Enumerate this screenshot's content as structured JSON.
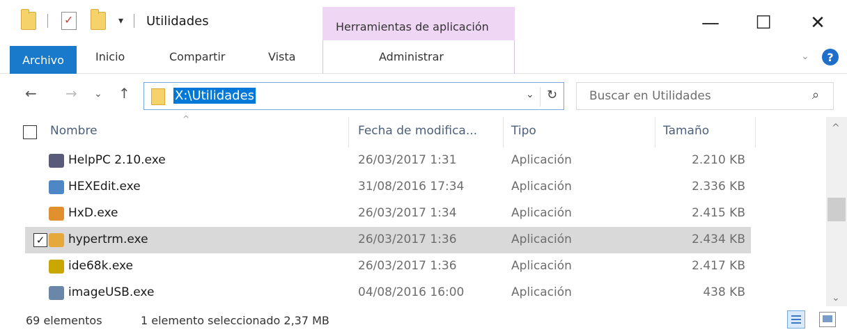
{
  "window": {
    "title": "Utilidades",
    "qa_dropdown": "▾",
    "minimize": "—",
    "maximize": "☐",
    "close": "✕"
  },
  "ribbon": {
    "contextual_header": "Herramientas de aplicación",
    "tabs": [
      "Archivo",
      "Inicio",
      "Compartir",
      "Vista"
    ],
    "contextual_tab": "Administrar",
    "expand": "⌄",
    "help": "?"
  },
  "navigation": {
    "back": "←",
    "forward": "→",
    "recent": "⌄",
    "up": "↑",
    "address": "X:\\Utilidades",
    "address_dropdown": "⌄",
    "refresh": "↻",
    "search_placeholder": "Buscar en Utilidades",
    "search_icon": "⌕"
  },
  "columns": {
    "name": "Nombre",
    "date": "Fecha de modifica...",
    "type": "Tipo",
    "size": "Tamaño",
    "sort_indicator": "^"
  },
  "files": [
    {
      "name": "HelpPC 2.10.exe",
      "date": "26/03/2017 1:31",
      "type": "Aplicación",
      "size": "2.210 KB",
      "icon": "helppc-icon",
      "icon_color": "#5a5a7a",
      "selected": false
    },
    {
      "name": "HEXEdit.exe",
      "date": "31/08/2016 17:34",
      "type": "Aplicación",
      "size": "2.336 KB",
      "icon": "hexedit-icon",
      "icon_color": "#4f86c6",
      "selected": false
    },
    {
      "name": "HxD.exe",
      "date": "26/03/2017 1:34",
      "type": "Aplicación",
      "size": "2.415 KB",
      "icon": "hxd-icon",
      "icon_color": "#e0902e",
      "selected": false
    },
    {
      "name": "hypertrm.exe",
      "date": "26/03/2017 1:36",
      "type": "Aplicación",
      "size": "2.434 KB",
      "icon": "hypertrm-icon",
      "icon_color": "#e6a83a",
      "selected": true
    },
    {
      "name": "ide68k.exe",
      "date": "26/03/2017 1:36",
      "type": "Aplicación",
      "size": "2.417 KB",
      "icon": "ide68k-icon",
      "icon_color": "#c9a600",
      "selected": false
    },
    {
      "name": "imageUSB.exe",
      "date": "04/08/2016 16:00",
      "type": "Aplicación",
      "size": "438 KB",
      "icon": "imageusb-icon",
      "icon_color": "#6a86a8",
      "selected": false
    }
  ],
  "scrollbar": {
    "up": "^",
    "down": "⌄"
  },
  "status": {
    "count": "69 elementos",
    "selection": "1 elemento seleccionado  2,37 MB"
  },
  "colors": {
    "accent": "#1979ca",
    "contextual": "#efd6f5",
    "selection": "#d9d9d9"
  }
}
